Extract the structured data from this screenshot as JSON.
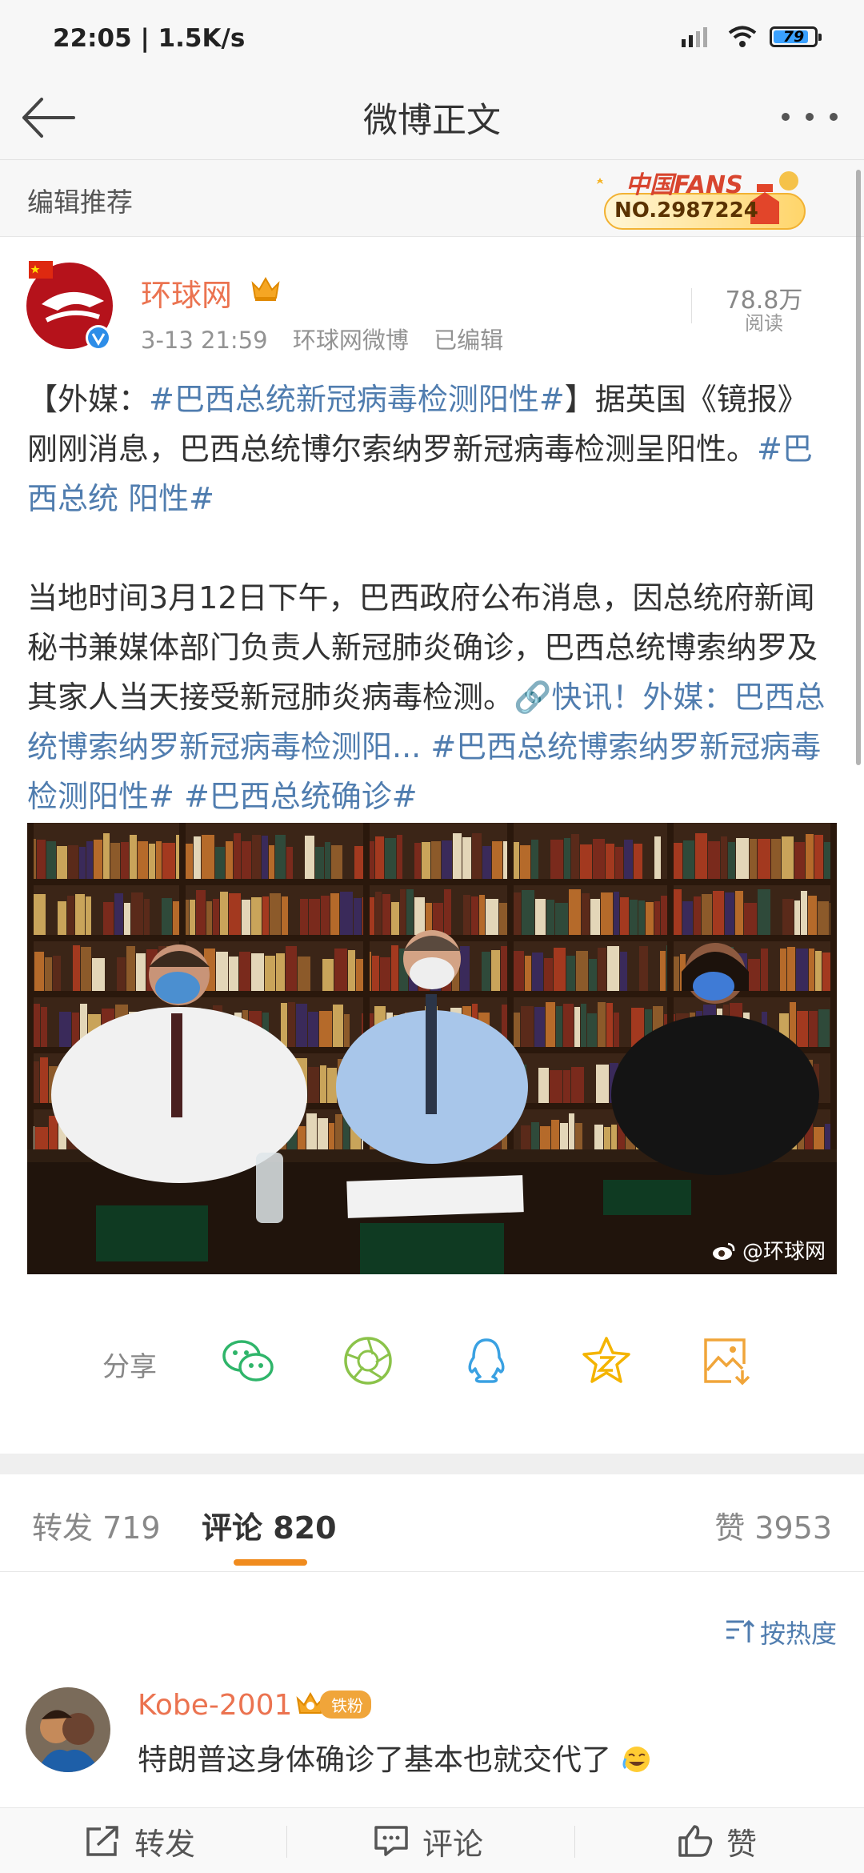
{
  "status_bar": {
    "time": "22:05 | 1.5K/s",
    "battery": "79"
  },
  "nav": {
    "title": "微博正文"
  },
  "recommend": {
    "label": "编辑推荐",
    "fans_title": "中国FANS",
    "fans_no": "NO.2987224"
  },
  "post": {
    "author": "环球网",
    "time": "3-13 21:59",
    "source": "环球网微博",
    "edited": "已编辑",
    "read_count": "78.8万",
    "read_label": "阅读",
    "para1": [
      {
        "text": "【外媒：",
        "tag": false
      },
      {
        "text": "#巴西总统新冠病毒检测阳性#",
        "tag": true
      },
      {
        "text": "】据英国《镜报》刚刚消息，巴西总统博尔索纳罗新冠病毒检测呈阳性。",
        "tag": false
      },
      {
        "text": "#巴西总统 阳性#",
        "tag": true
      }
    ],
    "para2": [
      {
        "text": "当地时间3月12日下午，巴西政府公布消息，因总统府新闻秘书兼媒体部门负责人新冠肺炎确诊，巴西总统博索纳罗及其家人当天接受新冠肺炎病毒检测。",
        "tag": false
      },
      {
        "text": "🔗快讯！外媒：巴西总统博索纳罗新冠病毒检测阳...",
        "tag": true
      },
      {
        "text": "  ",
        "tag": false
      },
      {
        "text": "#巴西总统博索纳罗新冠病毒检测阳性#",
        "tag": true
      },
      {
        "text": "  ",
        "tag": false
      },
      {
        "text": "#巴西总统确诊#",
        "tag": true
      }
    ],
    "watermark": "@环球网"
  },
  "share": {
    "label": "分享",
    "icons": [
      "wechat-icon",
      "moments-icon",
      "qq-icon",
      "qzone-icon",
      "save-image-icon"
    ]
  },
  "tabs": {
    "repost": "转发 719",
    "comment": "评论 820",
    "like": "赞 3953"
  },
  "sort": {
    "label": "按热度"
  },
  "comment": {
    "user": "Kobe-2001",
    "badge": "铁粉",
    "text": "特朗普这身体确诊了基本也就交代了"
  },
  "toolbar": {
    "repost": "转发",
    "comment": "评论",
    "like": "赞"
  },
  "colors": {
    "accent_orange": "#eb7350",
    "link_blue": "#507daf",
    "tab_indicator": "#f08b1e"
  }
}
